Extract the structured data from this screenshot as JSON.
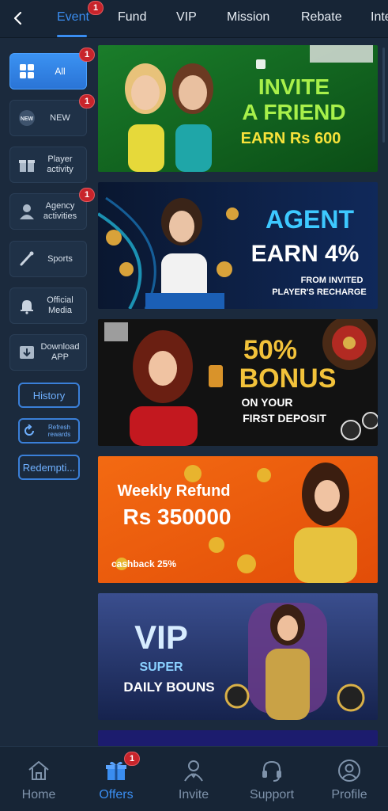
{
  "tabs": [
    {
      "label": "Event",
      "badge": "1"
    },
    {
      "label": "Fund"
    },
    {
      "label": "VIP"
    },
    {
      "label": "Mission"
    },
    {
      "label": "Rebate"
    },
    {
      "label": "Inte"
    }
  ],
  "sidebar": {
    "items": [
      {
        "label": "All",
        "badge": "1",
        "icon": "grid-icon"
      },
      {
        "label": "NEW",
        "badge": "1",
        "icon": "new-icon"
      },
      {
        "label": "Player activity",
        "icon": "gift-icon"
      },
      {
        "label": "Agency activities",
        "badge": "1",
        "icon": "agent-icon"
      },
      {
        "label": "Sports",
        "icon": "sports-icon"
      },
      {
        "label": "Official Media",
        "icon": "bell-icon"
      },
      {
        "label": "Download APP",
        "icon": "download-icon"
      }
    ],
    "buttons": {
      "history": "History",
      "refresh": "Refresh rewards",
      "redemption": "Redempti..."
    }
  },
  "banners": [
    {
      "line1": "INVITE",
      "line2": "A FRIEND",
      "line3": "EARN Rs 600"
    },
    {
      "line1": "AGENT",
      "line2": "EARN 4%",
      "line3": "FROM INVITED",
      "line4": "PLAYER'S RECHARGE"
    },
    {
      "line1": "50%",
      "line2": "BONUS",
      "line3": "ON YOUR",
      "line4": "FIRST DEPOSIT"
    },
    {
      "line1": "Weekly Refund",
      "line2": "Rs 350000",
      "line3": "cashback 25%"
    },
    {
      "line1": "VIP",
      "line2": "SUPER",
      "line3": "DAILY BOUNS"
    }
  ],
  "bottom_nav": [
    {
      "label": "Home",
      "icon": "home-icon"
    },
    {
      "label": "Offers",
      "icon": "gift-box-icon",
      "badge": "1"
    },
    {
      "label": "Invite",
      "icon": "invite-icon"
    },
    {
      "label": "Support",
      "icon": "headset-icon"
    },
    {
      "label": "Profile",
      "icon": "profile-icon"
    }
  ],
  "colors": {
    "accent": "#3a8df0",
    "background": "#1b2a3d",
    "badge": "#c8242b"
  }
}
